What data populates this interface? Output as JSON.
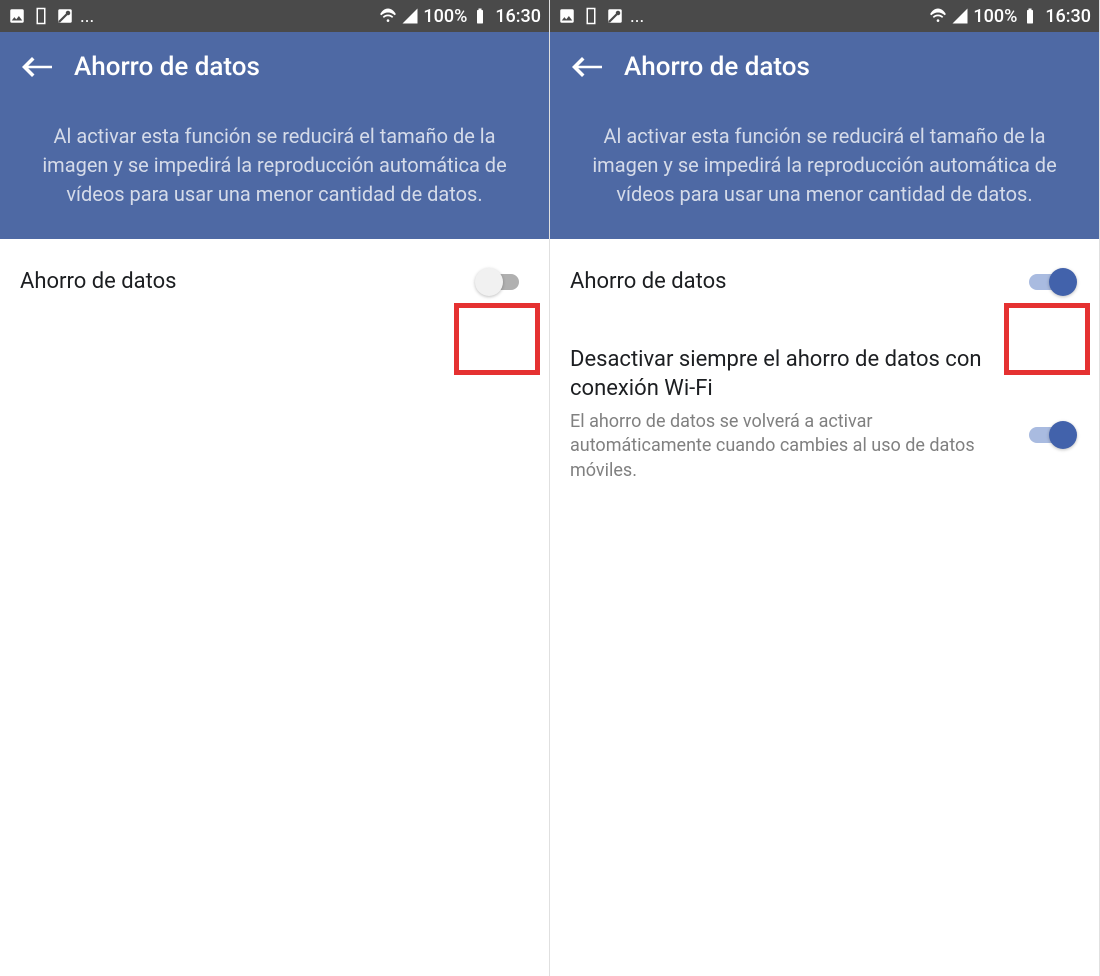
{
  "status": {
    "battery_pct": "100%",
    "time": "16:30",
    "more": "..."
  },
  "header": {
    "title": "Ahorro de datos",
    "description": "Al activar esta función se reducirá el tamaño de la imagen y se impedirá la reproducción automática de vídeos para usar una menor cantidad de datos."
  },
  "left": {
    "row1_label": "Ahorro de datos",
    "row1_on": false
  },
  "right": {
    "row1_label": "Ahorro de datos",
    "row1_on": true,
    "row2_label": "Desactivar siempre el ahorro de datos con conexión Wi-Fi",
    "row2_sub": "El ahorro de datos se volverá a activar automáticamente cuando cambies al uso de datos móviles.",
    "row2_on": true
  }
}
